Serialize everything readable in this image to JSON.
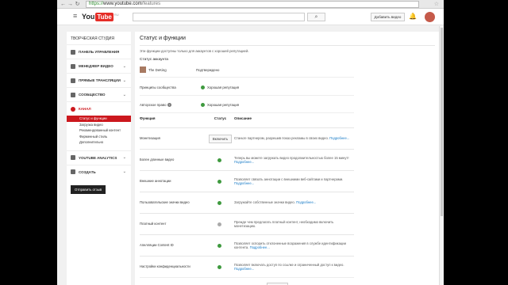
{
  "browser": {
    "url_scheme": "https://",
    "url_host": "www.youtube.com",
    "url_path": "/features",
    "back_icon": "arrow-left",
    "forward_icon": "arrow-right",
    "reload_icon": "reload"
  },
  "topbar": {
    "logo_you": "You",
    "logo_tube": "Tube",
    "logo_country": "RU",
    "search_button_icon": "search",
    "upload_label": "Добавить видео"
  },
  "sidebar": {
    "title": "ТВОРЧЕСКАЯ СТУДИЯ",
    "items": [
      {
        "label": "ПАНЕЛЬ УПРАВЛЕНИЯ",
        "arrow": ""
      },
      {
        "label": "МЕНЕДЖЕР ВИДЕО",
        "arrow": "⌄"
      },
      {
        "label": "ПРЯМЫЕ ТРАНСЛЯЦИИ",
        "arrow": "⌄"
      },
      {
        "label": "СООБЩЕСТВО",
        "arrow": "⌄"
      },
      {
        "label": "КАНАЛ",
        "arrow": ""
      }
    ],
    "subitems": [
      "Статус и функции",
      "Загрузка видео",
      "Рекомендованный контент",
      "Фирменный стиль",
      "Дополнительно"
    ],
    "items2": [
      {
        "label": "YOUTUBE ANALYTICS",
        "arrow": "⌄"
      },
      {
        "label": "СОЗДАТЬ",
        "arrow": "⌄"
      }
    ],
    "feedback": "Отправить отзыв"
  },
  "main": {
    "title": "Статус и функции",
    "note": "Эти функции доступны только для аккаунтов с хорошей репутацией.",
    "account_title": "Статус аккаунта",
    "account_name": "The DeKing",
    "account_status": "Подтверждено",
    "principles_label": "Принципы сообщества",
    "principles_value": "Хорошая репутация",
    "copyright_label": "Авторское право",
    "copyright_value": "Хорошая репутация",
    "col_feature": "Функция",
    "col_status": "Статус",
    "col_desc": "Описание",
    "more": "Подробнее...",
    "features": [
      {
        "name": "Монетизация",
        "status": "button",
        "button": "Включить",
        "desc": "Станьте партнером, разрешив показ рекламы в своих видео."
      },
      {
        "name": "Более длинные видео",
        "status": "green",
        "desc": "Теперь вы можете загружать видео продолжительностью более 15 минут!"
      },
      {
        "name": "Внешние аннотации",
        "status": "green",
        "desc": "Позволяет связать аннотации с внешними веб-сайтами и партнерами."
      },
      {
        "name": "Пользовательские значки видео",
        "status": "green",
        "desc": "Загружайте собственные значки видео."
      },
      {
        "name": "Платный контент",
        "status": "gray",
        "desc": "Прежде чем предлагать платный контент, необходимо включить монетизацию."
      },
      {
        "name": "Апелляции Content ID",
        "status": "green",
        "desc": "Позволяет оспорить отклоненные возражения в службе идентификации контента."
      },
      {
        "name": "Настройки конфиденциальности",
        "status": "green",
        "desc": "Позволяет включать доступ по ссылке и ограниченный доступ к видео."
      }
    ]
  },
  "colors": {
    "brand_red": "#e52d27",
    "active_red": "#cc181e",
    "ok_green": "#3f9a3f",
    "link_blue": "#167ac6"
  }
}
